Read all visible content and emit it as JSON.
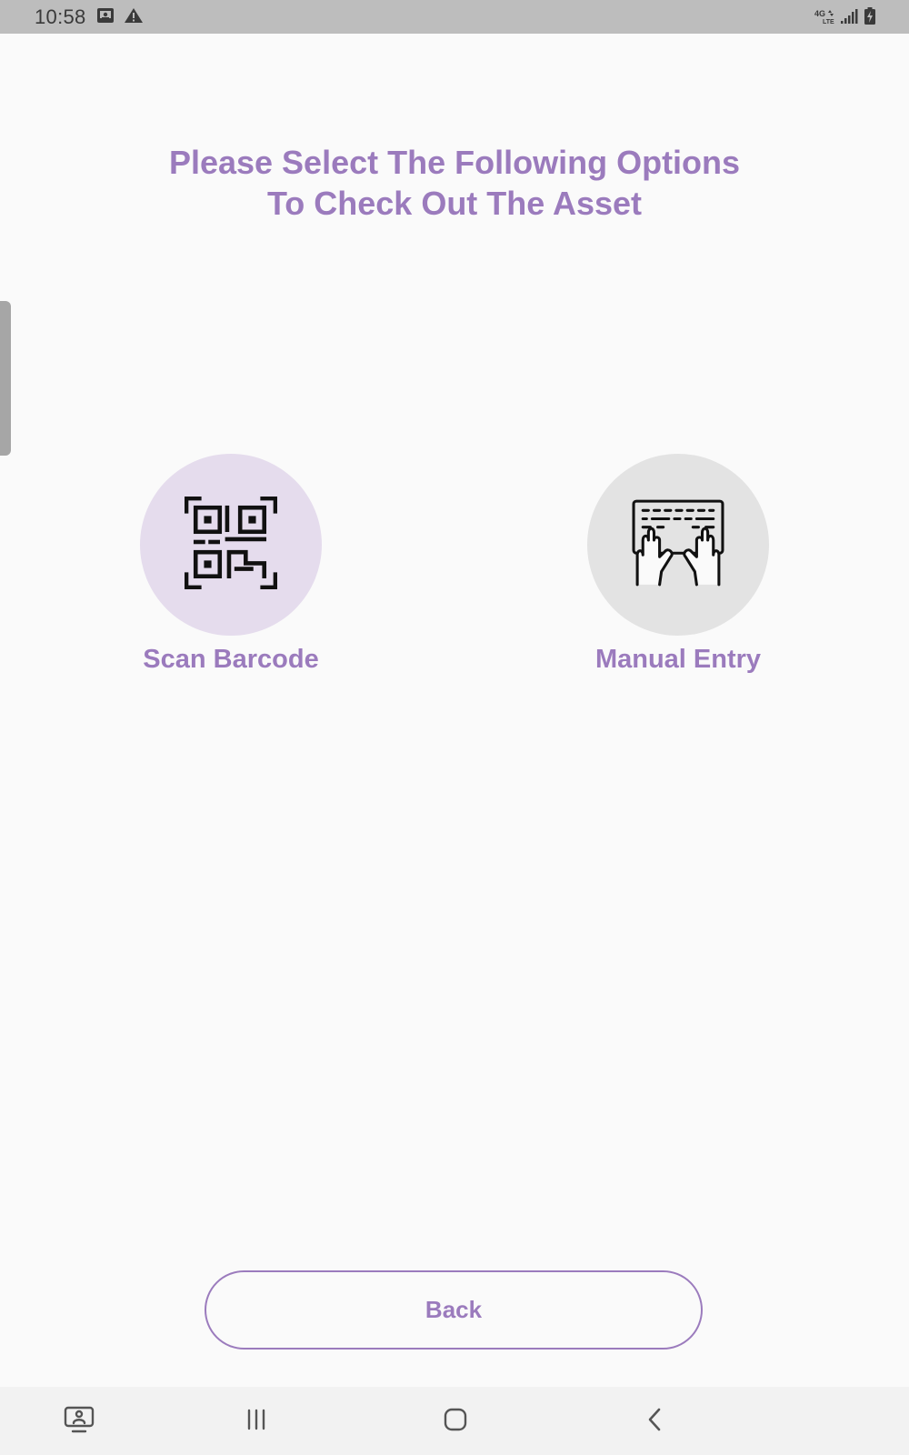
{
  "status_bar": {
    "time": "10:58",
    "left_icons": [
      "screenshot-icon",
      "warning-icon"
    ],
    "network_label": "4G LTE",
    "right_icons": [
      "network-4g-icon",
      "signal-icon",
      "battery-charging-icon"
    ]
  },
  "heading": {
    "line1": "Please Select The Following Options",
    "line2": "To Check Out The Asset"
  },
  "options": {
    "scan": {
      "label": "Scan Barcode",
      "icon": "qr-code-icon",
      "circle_color": "#e5dced"
    },
    "manual": {
      "label": "Manual Entry",
      "icon": "keyboard-typing-icon",
      "circle_color": "#e3e3e3"
    }
  },
  "back_button": {
    "label": "Back"
  },
  "nav_bar": {
    "buttons": [
      "keyboard-switch-icon",
      "recent-apps-icon",
      "home-icon",
      "back-icon"
    ]
  },
  "colors": {
    "accent": "#9b7bbd",
    "background": "#fafafa",
    "status_bar": "#bdbdbd",
    "nav_bar": "#f2f2f2"
  }
}
